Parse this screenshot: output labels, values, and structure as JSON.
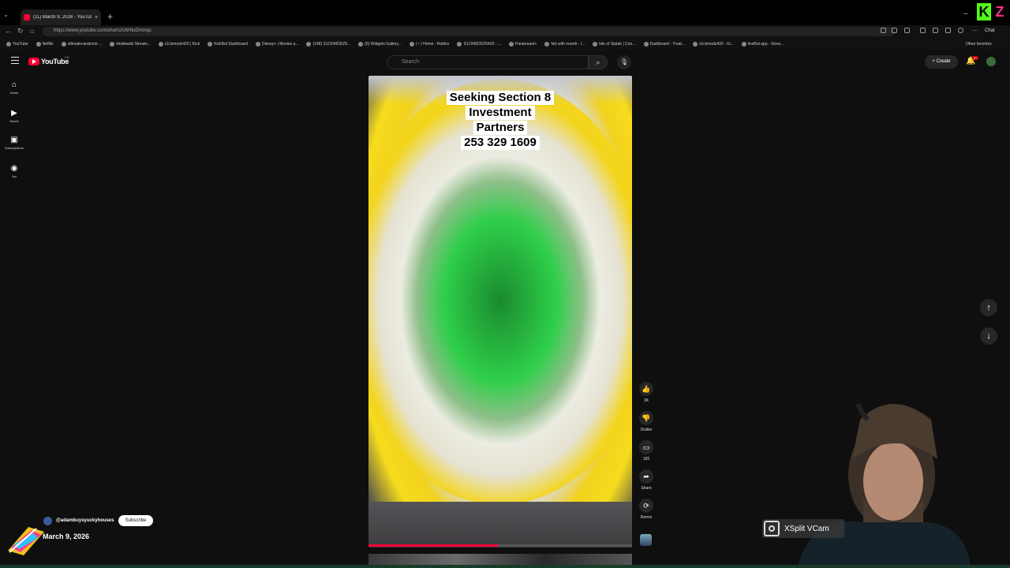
{
  "browser": {
    "tab_title": "(11) March 9, 2026 - YouTube",
    "new_tab_symbol": "+",
    "url": "https://www.youtube.com/shorts/UhHtuDmmqc",
    "chat_label": "Chat",
    "bookmarks": [
      "YouTube",
      "Netflix",
      "ultimatecardzone ...",
      "timdewski Stream...",
      "s1ckmodz420 | Kick",
      "KickBot Dashboard",
      "Disney+ | Movies a...",
      "(148) S1CKMODZ5...",
      "(6) Widgets Gallery...",
      "( • ) Home - Roblox",
      "S1CKMODZ5420 - ...",
      "Paramount+",
      "fart with reverb - l...",
      "Isle of Siptah | Con...",
      "Dashboard - Treat...",
      "s1ckmodz420 - Ki...",
      "liveBot.app - Strea..."
    ],
    "other_favorites": "Other favorites"
  },
  "youtube": {
    "logo_text": "YouTube",
    "country_code": "CA",
    "search_placeholder": "Search",
    "create_label": "+ Create",
    "notification_count": "9+",
    "nav": [
      {
        "icon": "home-icon",
        "label": "Home"
      },
      {
        "icon": "shorts-icon",
        "label": "Shorts"
      },
      {
        "icon": "subscriptions-icon",
        "label": "Subscriptions"
      },
      {
        "icon": "you-icon",
        "label": "You"
      }
    ]
  },
  "short": {
    "caption_lines": [
      "Seeking Section 8",
      "Investment",
      "Partners",
      "253 329 1609"
    ],
    "progress": 0.49,
    "actions": {
      "like_count": "3K",
      "dislike_label": "Dislike",
      "comment_count": "165",
      "share_label": "Share",
      "remix_label": "Remix"
    },
    "channel_handle": "@adambuysyuckyhouses",
    "subscribe_label": "Subscribe",
    "date_text": "March 9, 2026"
  },
  "overlay": {
    "xsplit_label": "XSplit VCam"
  },
  "colors": {
    "background": "#0f0f0f",
    "youtube_red": "#ff0033",
    "kick_green": "#53fc18"
  }
}
